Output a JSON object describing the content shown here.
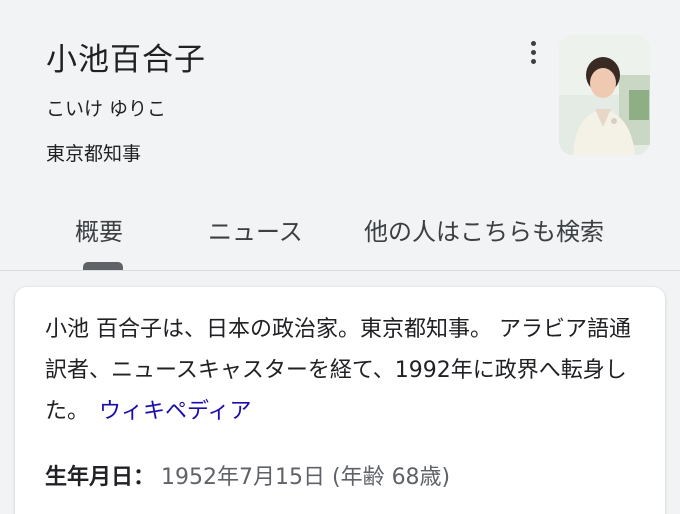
{
  "header": {
    "title": "小池百合子",
    "reading": "こいけ ゆりこ",
    "role": "東京都知事"
  },
  "tabs": [
    {
      "label": "概要",
      "active": true
    },
    {
      "label": "ニュース",
      "active": false
    },
    {
      "label": "他の人はこちらも検索",
      "active": false
    }
  ],
  "card": {
    "description": "小池 百合子は、日本の政治家。東京都知事。 アラビア語通訳者、ニュースキャスターを経て、1992年に政界へ転身した。",
    "source_link": "ウィキペディア",
    "facts": [
      {
        "label": "生年月日：",
        "value": "1952年7月15日 (年齢 68歳)"
      }
    ]
  },
  "colors": {
    "background": "#f1f3f4",
    "card": "#ffffff",
    "link": "#1a0dab",
    "text": "#202124",
    "secondary_text": "#5f6368"
  },
  "icons": [
    "more-vert-icon",
    "profile-photo"
  ]
}
